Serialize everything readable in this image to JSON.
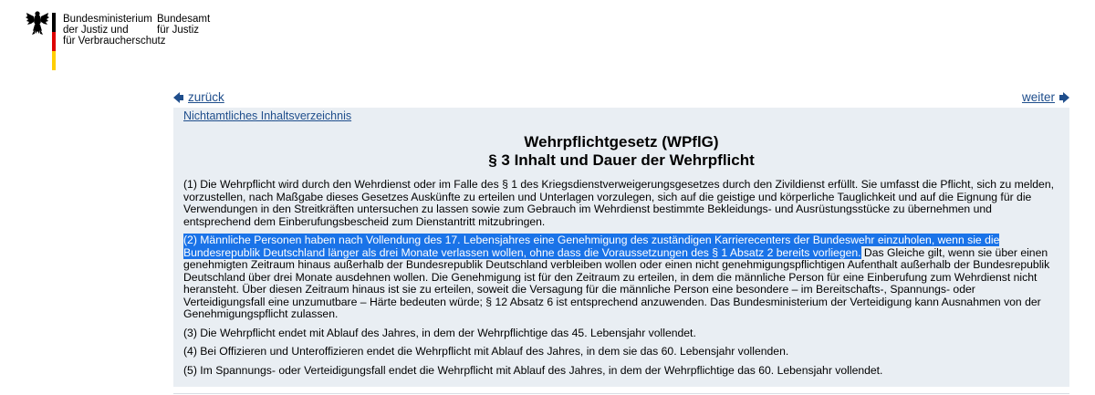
{
  "header": {
    "ministry_lines": [
      "Bundesministerium",
      "der Justiz und",
      "für Verbraucherschutz"
    ],
    "office_lines": [
      "Bundesamt",
      "für Justiz"
    ]
  },
  "nav": {
    "back_label": "zurück",
    "next_label": "weiter",
    "toc_label": "Nichtamtliches Inhaltsverzeichnis"
  },
  "law": {
    "title": "Wehrpflichtgesetz (WPflG)",
    "section": "§ 3 Inhalt und Dauer der Wehrpflicht",
    "p1": "(1) Die Wehrpflicht wird durch den Wehrdienst oder im Falle des § 1 des Kriegsdienstverweigerungsgesetzes durch den Zivildienst erfüllt. Sie umfasst die Pflicht, sich zu melden, vorzustellen, nach Maßgabe dieses Gesetzes Auskünfte zu erteilen und Unterlagen vorzulegen, sich auf die geistige und körperliche Tauglichkeit und auf die Eignung für die Verwendungen in den Streitkräften untersuchen zu lassen sowie zum Gebrauch im Wehrdienst bestimmte Bekleidungs- und Ausrüstungsstücke zu übernehmen und entsprechend dem Einberufungsbescheid zum Dienstantritt mitzubringen.",
    "p2_highlight": "(2) Männliche Personen haben nach Vollendung des 17. Lebensjahres eine Genehmigung des zuständigen Karrierecenters der Bundeswehr einzuholen, wenn sie die Bundesrepublik Deutschland länger als drei Monate verlassen wollen, ohne dass die Voraussetzungen des § 1 Absatz 2 bereits vorliegen.",
    "p2_rest": " Das Gleiche gilt, wenn sie über einen genehmigten Zeitraum hinaus außerhalb der Bundesrepublik Deutschland verbleiben wollen oder einen nicht genehmigungspflichtigen Aufenthalt außerhalb der Bundesrepublik Deutschland über drei Monate ausdehnen wollen. Die Genehmigung ist für den Zeitraum zu erteilen, in dem die männliche Person für eine Einberufung zum Wehrdienst nicht heransteht. Über diesen Zeitraum hinaus ist sie zu erteilen, soweit die Versagung für die männliche Person eine besondere – im Bereitschafts-, Spannungs- oder Verteidigungsfall eine unzumutbare – Härte bedeuten würde; § 12 Absatz 6 ist entsprechend anzuwenden. Das Bundesministerium der Verteidigung kann Ausnahmen von der Genehmigungspflicht zulassen.",
    "p3": "(3) Die Wehrpflicht endet mit Ablauf des Jahres, in dem der Wehrpflichtige das 45. Lebensjahr vollendet.",
    "p4": "(4) Bei Offizieren und Unteroffizieren endet die Wehrpflicht mit Ablauf des Jahres, in dem sie das 60. Lebensjahr vollenden.",
    "p5": "(5) Im Spannungs- oder Verteidigungsfall endet die Wehrpflicht mit Ablauf des Jahres, in dem der Wehrpflichtige das 60. Lebensjahr vollendet."
  },
  "colors": {
    "link": "#1f4e8c",
    "panel_bg": "#e9eef3",
    "selection": "#1a73e8",
    "flag": [
      "#000000",
      "#dd0000",
      "#ffce00"
    ]
  },
  "icons": [
    "federal-eagle-icon",
    "arrow-left-icon",
    "arrow-right-icon"
  ]
}
